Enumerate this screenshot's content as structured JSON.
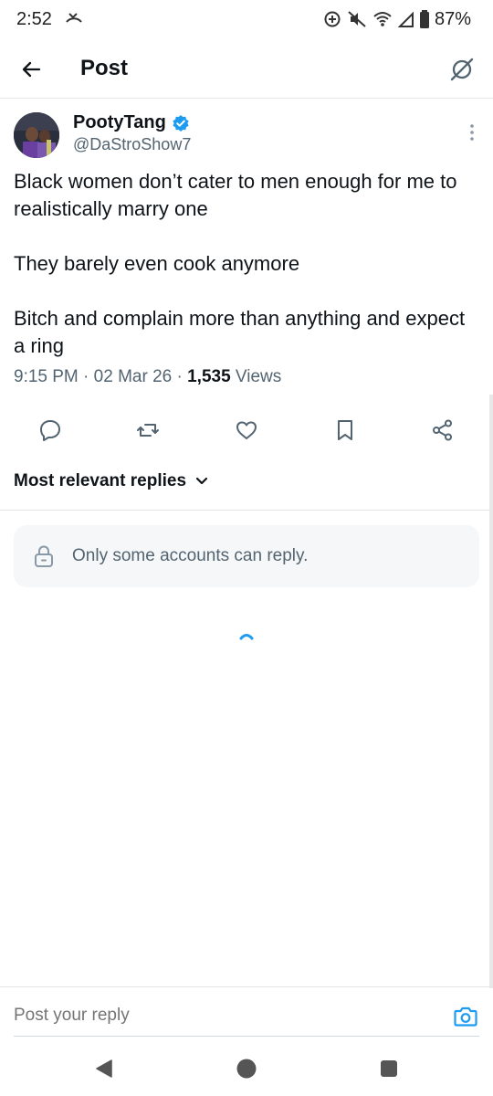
{
  "status_bar": {
    "time": "2:52",
    "battery": "87%"
  },
  "header": {
    "title": "Post"
  },
  "post": {
    "author_name": "PootyTang",
    "author_handle": "@DaStroShow7",
    "verified": true,
    "paragraphs": [
      "Black women don’t cater to men enough for me to realistically marry one",
      "They barely even cook anymore",
      "Bitch and complain more than anything and expect a ring"
    ],
    "time": "9:15 PM",
    "date": "02 Mar 26",
    "views_count": "1,535",
    "views_label": "Views",
    "meta_separator": " · "
  },
  "actions": [
    "reply-icon",
    "repost-icon",
    "like-icon",
    "bookmark-icon",
    "share-icon"
  ],
  "replies": {
    "sort_label": "Most relevant replies",
    "notice": "Only some accounts can reply."
  },
  "reply_bar": {
    "placeholder": "Post your reply"
  },
  "colors": {
    "accent": "#1d9bf0",
    "text": "#0f1419",
    "muted": "#536471"
  }
}
